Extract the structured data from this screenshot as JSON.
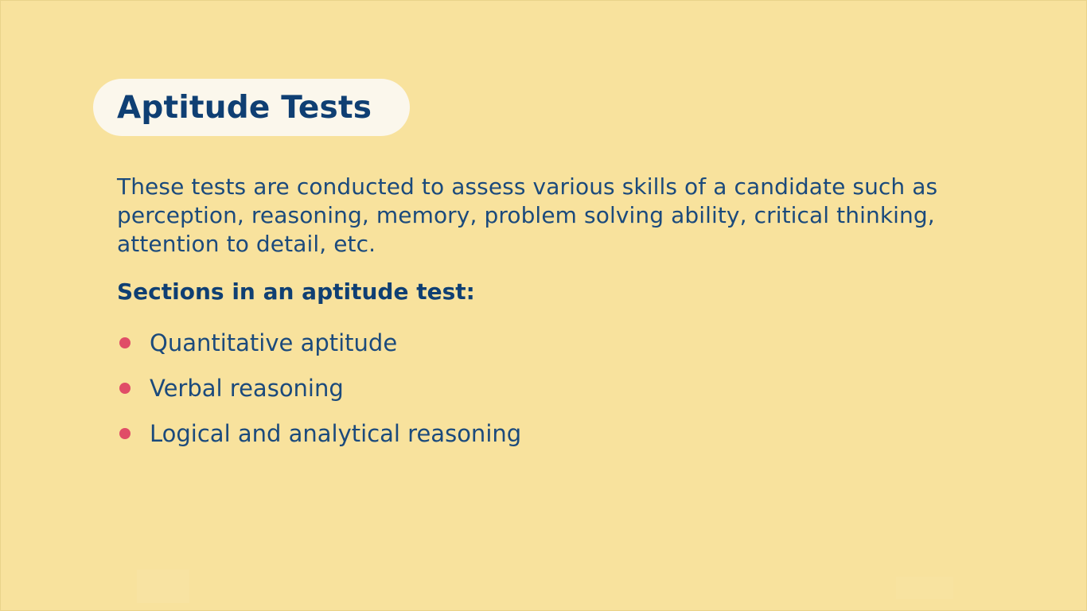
{
  "slide": {
    "title": "Aptitude Tests",
    "intro_text": "These tests are conducted to assess various skills of a candidate such as perception, reasoning, memory, problem solving ability, critical thinking, attention to detail, etc.",
    "sections_heading": "Sections in an aptitude test:",
    "bullets": [
      "Quantitative aptitude",
      "Verbal reasoning",
      "Logical and analytical reasoning"
    ]
  },
  "colors": {
    "background": "#f8e29d",
    "title_pill": "#fbf7ec",
    "title_text": "#0f3f73",
    "body_text": "#1b4a7c",
    "bullet_dot": "#e04d67"
  }
}
